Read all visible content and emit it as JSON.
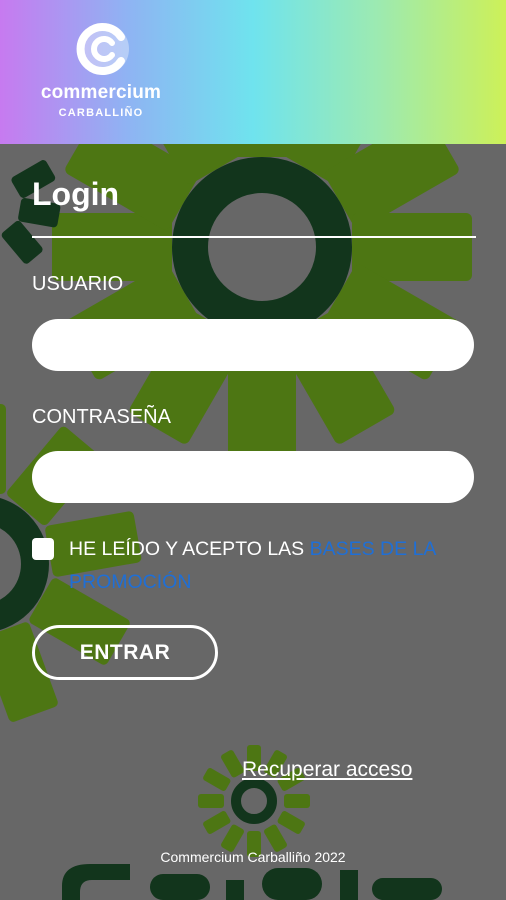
{
  "brand": {
    "name": "commercium",
    "sub": "CARBALLIÑO",
    "logo_icon": "commercium-c-logo"
  },
  "colors": {
    "gradient": [
      "#c77af0",
      "#8fb3f3",
      "#6fe3ee",
      "#9deab0",
      "#cdf058"
    ],
    "background": "#676767",
    "link": "#1f6fd6",
    "art_green": "#4d7613",
    "art_dark": "#12351c"
  },
  "login": {
    "title": "Login",
    "user_label": "USUARIO",
    "user_value": "",
    "pass_label": "CONTRASEÑA",
    "pass_value": "",
    "accept_prefix": "HE LEÍDO Y ACEPTO LAS ",
    "accept_link": "BASES DE LA PROMOCIÓN",
    "accept_checked": false,
    "submit": "ENTRAR",
    "recover": "Recuperar acceso"
  },
  "footer": {
    "text": "Commercium Carballiño 2022"
  }
}
